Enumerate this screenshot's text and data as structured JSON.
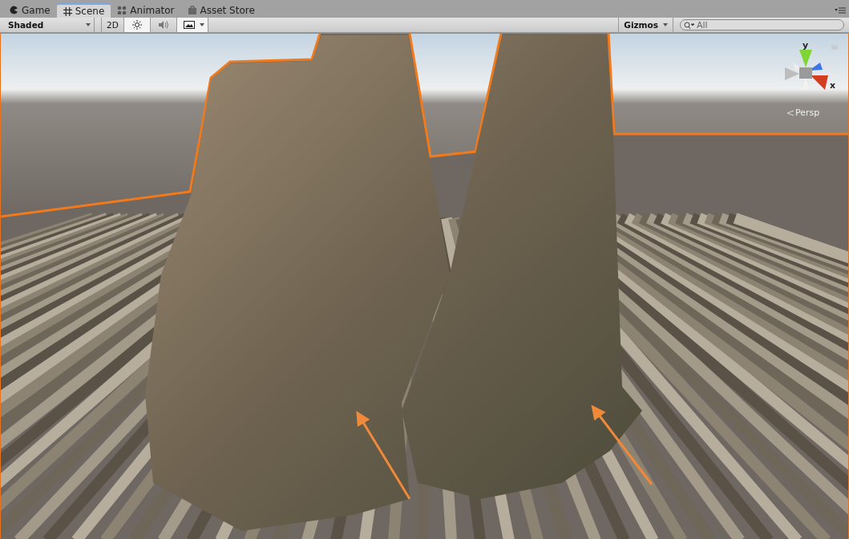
{
  "tabs": [
    {
      "label": "Game",
      "kind": "game",
      "selected": false
    },
    {
      "label": "Scene",
      "kind": "scene",
      "selected": true
    },
    {
      "label": "Animator",
      "kind": "animator",
      "selected": false
    },
    {
      "label": "Asset Store",
      "kind": "store",
      "selected": false
    }
  ],
  "toolbar": {
    "draw_mode": "Shaded",
    "toggles": [
      {
        "kind": "flat",
        "label": "2D",
        "on": false
      },
      {
        "kind": "light",
        "on": true
      },
      {
        "kind": "audio",
        "on": false
      },
      {
        "kind": "effects",
        "on": true
      }
    ],
    "gizmos": "Gizmos",
    "search": {
      "placeholder": "All"
    }
  },
  "scene_gizmo": {
    "y_label": "y",
    "x_label": "x",
    "projection": "Persp"
  }
}
